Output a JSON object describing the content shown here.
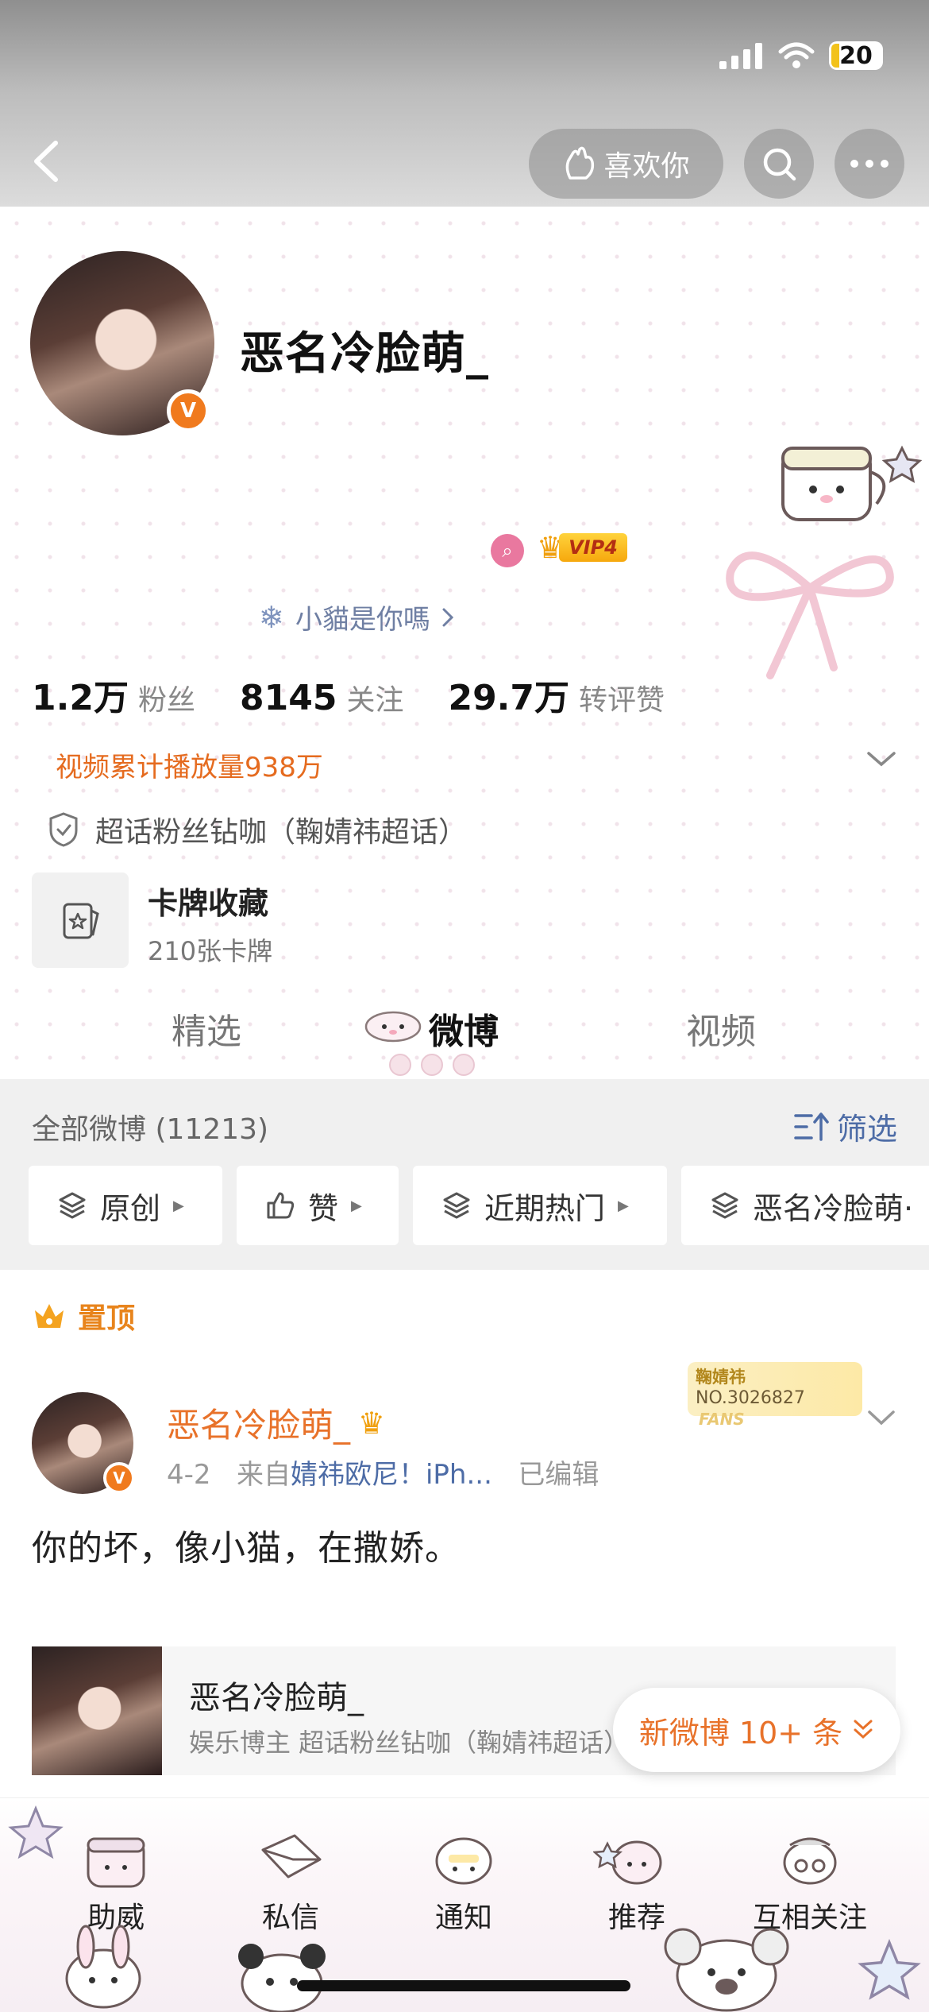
{
  "status_bar": {
    "battery": "20"
  },
  "header": {
    "like_label": "喜欢你"
  },
  "profile": {
    "name": "恶名冷脸萌_",
    "vip_label": "VIP4",
    "verify_mark": "V",
    "subtitle": "小貓是你嗎",
    "stats": [
      {
        "value": "1.2万",
        "label": "粉丝"
      },
      {
        "value": "8145",
        "label": "关注"
      },
      {
        "value": "29.7万",
        "label": "转评赞"
      }
    ],
    "video_views": "视频累计播放量938万",
    "supertopic": "超话粉丝钻咖（鞠婧祎超话）",
    "card_collection": {
      "title": "卡牌收藏",
      "count": "210张卡牌"
    }
  },
  "tabs": [
    {
      "label": "精选"
    },
    {
      "label": "微博",
      "active": true
    },
    {
      "label": "视频"
    }
  ],
  "feed_filter": {
    "all_label": "全部微博 (11213)",
    "filter_label": "筛选",
    "chips": [
      "原创",
      "赞",
      "近期热门",
      "恶名冷脸萌·"
    ]
  },
  "pinned_post": {
    "pinned_label": "置顶",
    "author": "恶名冷脸萌_",
    "date": "4-2",
    "source_prefix": "来自",
    "source": "婧祎欧尼！iPh...",
    "edited": "已编辑",
    "fans_badge_name": "鞠婧祎",
    "fans_badge_no": "NO.3026827",
    "fans_badge_word": "FANS",
    "text": "你的坏，像小猫，在撒娇。",
    "repost": {
      "name": "恶名冷脸萌_",
      "desc": "娱乐博主 超话粉丝钻咖（鞠婧祎超话）"
    }
  },
  "new_weibo_label": "新微博 10+ 条",
  "bottom_nav": [
    "助威",
    "私信",
    "通知",
    "推荐",
    "互相关注"
  ],
  "colors": {
    "accent_orange": "#e8722a",
    "link_blue": "#4d6ca6",
    "vip_gold": "#f6a80d"
  }
}
